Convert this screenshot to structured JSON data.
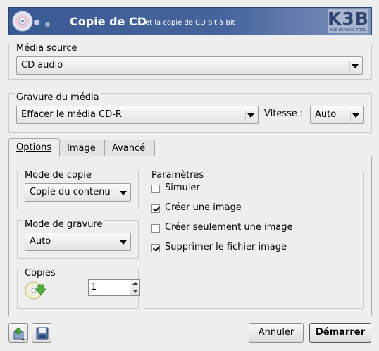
{
  "banner": {
    "title": "Copie de CD",
    "subtitle": "et la copie de CD bit à bit",
    "logo_text": "K3B",
    "logo_tagline": "KDE BURNING TOOL"
  },
  "source_group": {
    "title": "Média source",
    "selected": "CD audio"
  },
  "burn_group": {
    "title": "Gravure du média",
    "device_selected": "Effacer le média CD-R",
    "speed_label": "Vitesse :",
    "speed_selected": "Auto"
  },
  "tabs": [
    {
      "label": "Options",
      "active": true
    },
    {
      "label": "Image",
      "active": false
    },
    {
      "label": "Avancé",
      "active": false
    }
  ],
  "options": {
    "copy_mode": {
      "title": "Mode de copie",
      "selected": "Copie du contenu"
    },
    "write_mode": {
      "title": "Mode de gravure",
      "selected": "Auto"
    },
    "copies": {
      "title": "Copies",
      "value": "1",
      "icon": "cd-copies-icon"
    },
    "params": {
      "title": "Paramètres",
      "items": [
        {
          "label": "Simuler",
          "checked": false
        },
        {
          "label": "Créer une image",
          "checked": true
        },
        {
          "label": "Créer seulement une image",
          "checked": false
        },
        {
          "label": "Supprimer le fichier image",
          "checked": true
        }
      ]
    }
  },
  "footer": {
    "load_icon": "load-settings-icon",
    "save_icon": "save-settings-icon",
    "cancel_label": "Annuler",
    "start_label": "Démarrer"
  },
  "colors": {
    "banner": "#47659c",
    "window_bg": "#eeeeee"
  }
}
